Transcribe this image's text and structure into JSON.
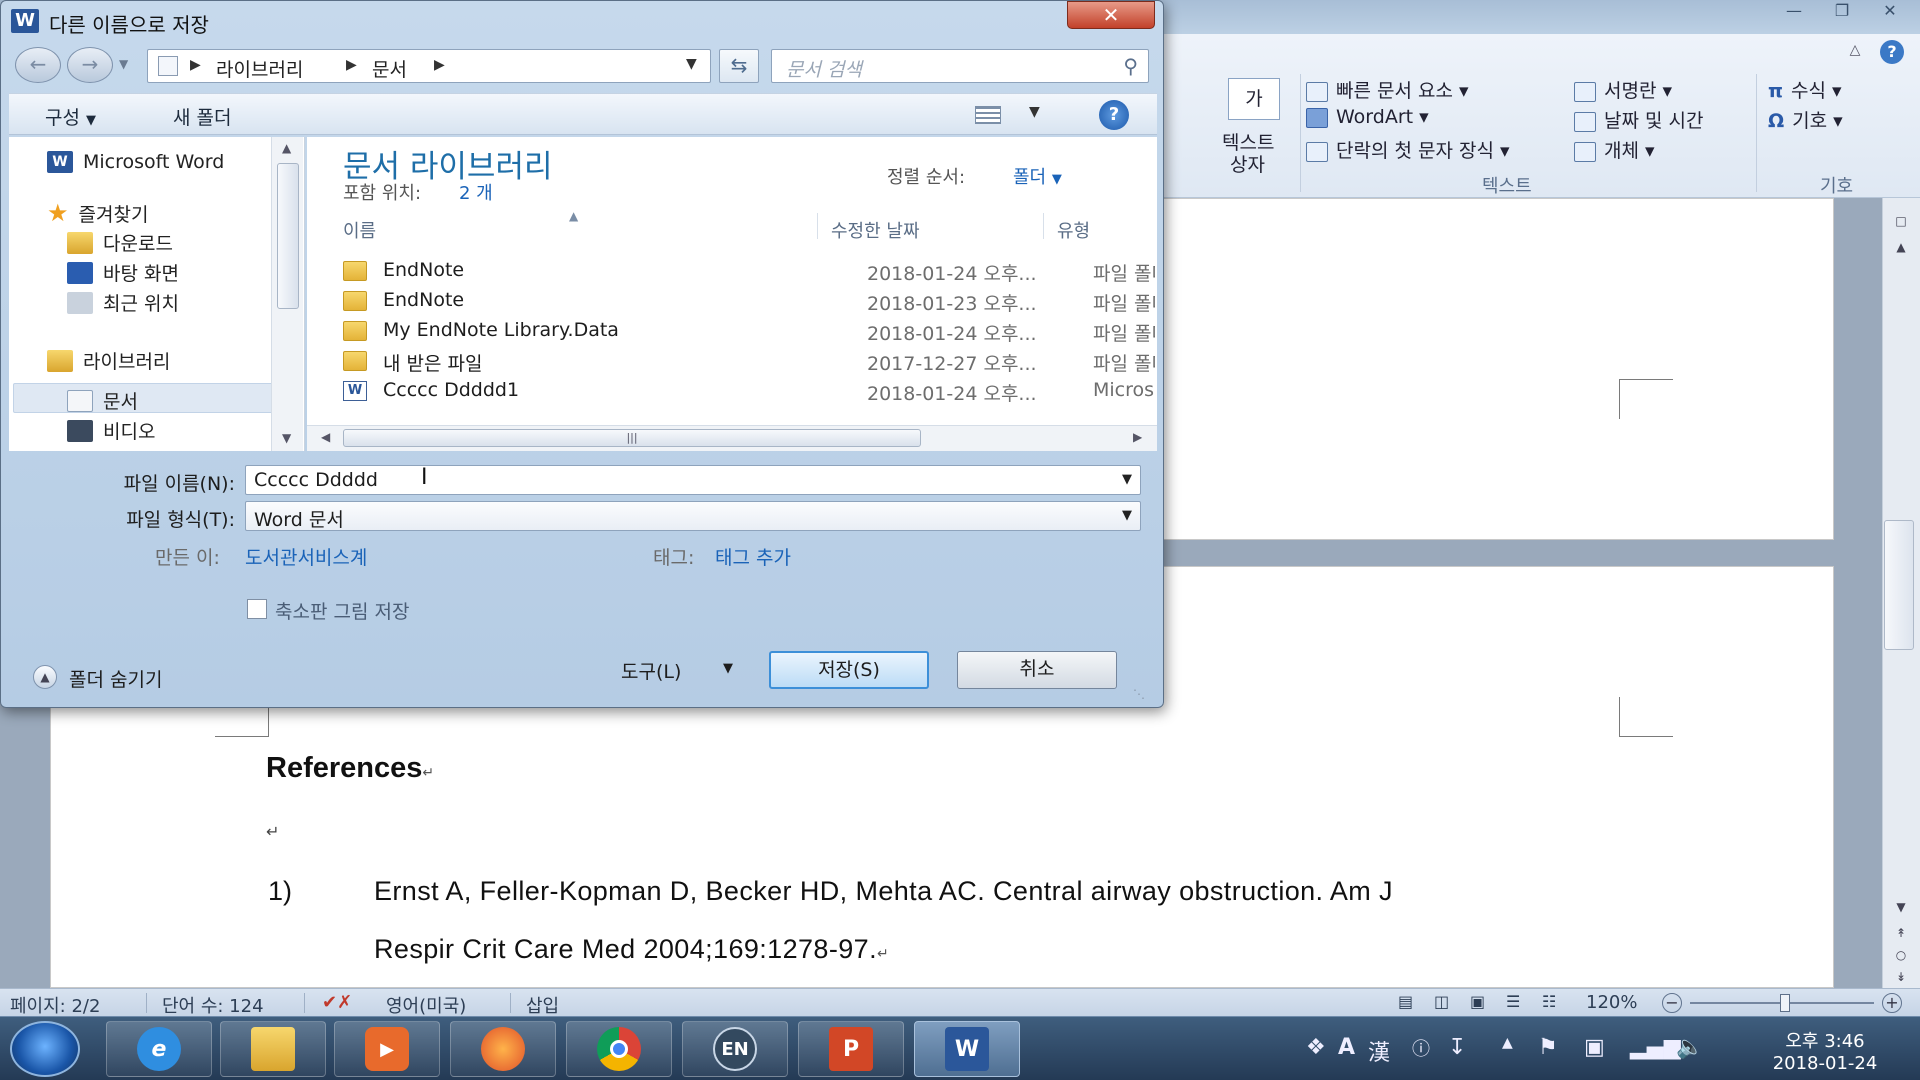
{
  "word": {
    "ribbon": {
      "textbox_label_line1": "텍스트",
      "textbox_label_line2": "상자",
      "quick_parts": "빠른 문서 요소",
      "wordart": "WordArt",
      "dropcap": "단락의 첫 문자 장식",
      "signature_line": "서명란",
      "date_time": "날짜 및 시간",
      "object": "개체",
      "equation": "수식",
      "symbol": "기호",
      "group_text": "텍스트",
      "group_symbols": "기호",
      "textbox_icon_text": "가"
    },
    "document": {
      "references_heading": "References",
      "paragraph_mark": "↵",
      "ref1_num": "1)",
      "ref1_line1": "Ernst A, Feller-Kopman D, Becker HD, Mehta AC. Central airway obstruction. Am J",
      "ref1_line2": "Respir Crit Care Med 2004;169:1278-97."
    },
    "statusbar": {
      "page": "페이지: 2/2",
      "words": "단어 수: 124",
      "language": "영어(미국)",
      "mode": "삽입",
      "zoom": "120%",
      "zoom_level_percent": 120
    }
  },
  "dialog": {
    "title": "다른 이름으로 저장",
    "breadcrumb": [
      "라이브러리",
      "문서"
    ],
    "search_placeholder": "문서 검색",
    "toolbar": {
      "organize": "구성",
      "new_folder": "새 폴더"
    },
    "nav": {
      "word_root": "Microsoft Word",
      "favorites": "즐겨찾기",
      "downloads": "다운로드",
      "desktop": "바탕 화면",
      "recent": "최근 위치",
      "libraries": "라이브러리",
      "documents": "문서",
      "videos": "비디오"
    },
    "library": {
      "title": "문서 라이브러리",
      "includes_label": "포함 위치:",
      "includes_value": "2 개",
      "sort_label": "정렬 순서:",
      "sort_value": "폴더"
    },
    "columns": {
      "name": "이름",
      "modified": "수정한 날짜",
      "type": "유형"
    },
    "files": [
      {
        "name": "EndNote",
        "date": "2018-01-24 오후...",
        "type": "파일 폴더",
        "icon": "folder-icon"
      },
      {
        "name": "EndNote",
        "date": "2018-01-23 오후...",
        "type": "파일 폴더",
        "icon": "folder-icon"
      },
      {
        "name": "My EndNote Library.Data",
        "date": "2018-01-24 오후...",
        "type": "파일 폴더",
        "icon": "folder-icon"
      },
      {
        "name": "내 받은 파일",
        "date": "2017-12-27 오후...",
        "type": "파일 폴더",
        "icon": "folder-icon"
      },
      {
        "name": "Ccccc Ddddd1",
        "date": "2018-01-24 오후...",
        "type": "Microsoft",
        "icon": "word-doc-icon"
      }
    ],
    "filename_label": "파일 이름(N):",
    "filename_value": "Ccccc Ddddd",
    "filetype_label": "파일 형식(T):",
    "filetype_value": "Word 문서",
    "author_label": "만든 이:",
    "author_value": "도서관서비스계",
    "tags_label": "태그:",
    "tags_value": "태그 추가",
    "thumbnail_label": "축소판 그림 저장",
    "hide_folders": "폴더 숨기기",
    "tools": "도구(L)",
    "save": "저장(S)",
    "cancel": "취소"
  },
  "taskbar": {
    "lang": "EN",
    "tray_a": "A",
    "tray_han": "漢",
    "time": "오후 3:46",
    "date": "2018-01-24"
  }
}
